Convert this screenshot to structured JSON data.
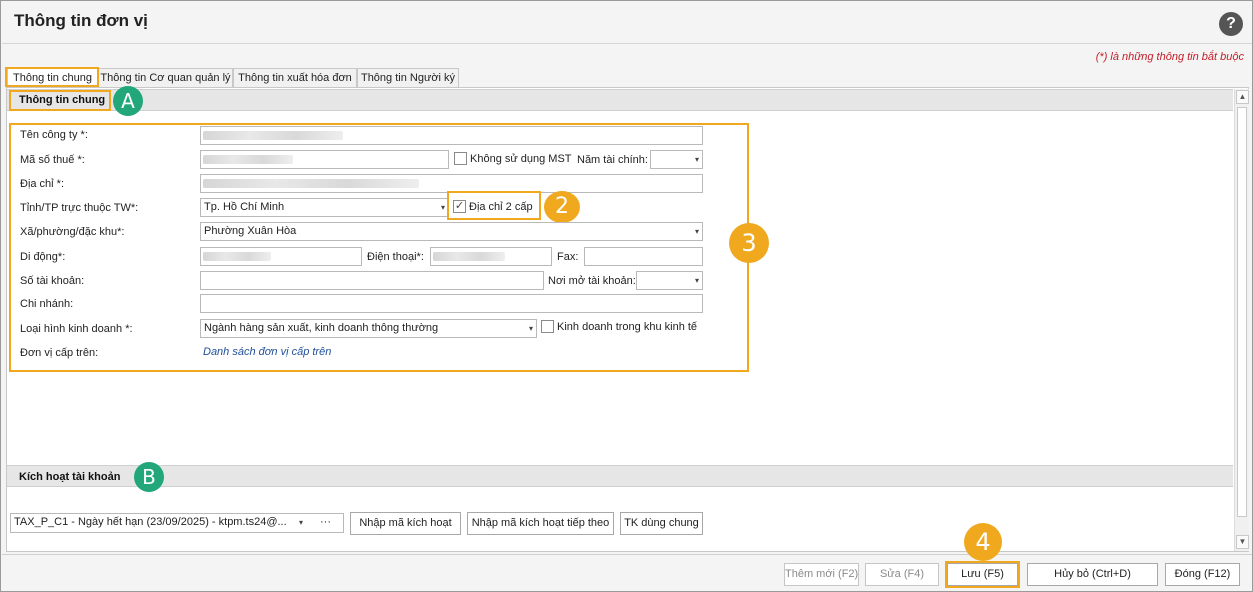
{
  "window": {
    "title": "Thông tin đơn vị",
    "help_label": "?"
  },
  "required_note": "(*)  là những thông tin bắt buộc",
  "tabs": [
    {
      "label": "Thông tin chung"
    },
    {
      "label": "Thông tin Cơ quan quản lý"
    },
    {
      "label": "Thông tin xuất hóa đơn"
    },
    {
      "label": "Thông tin Người ký"
    }
  ],
  "section_general": {
    "title": "Thông tin chung",
    "badge": "A"
  },
  "section_activation": {
    "title": "Kích hoạt tài khoản",
    "badge": "B"
  },
  "form": {
    "company_name_label": "Tên công ty *:",
    "tax_code_label": "Mã số thuế *:",
    "no_tax_code_label": "Không sử dụng MST",
    "fiscal_year_label": "Năm tài chính:",
    "address_label": "Địa chỉ *:",
    "province_label": "Tỉnh/TP trực thuộc TW*:",
    "province_value": "Tp. Hồ Chí Minh",
    "two_level_address_label": "Địa chỉ 2 cấp",
    "ward_label": "Xã/phường/đặc khu*:",
    "ward_value": "Phường Xuân Hòa",
    "mobile_label": "Di động*:",
    "phone_label": "Điện thoại*:",
    "fax_label": "Fax:",
    "account_no_label": "Số tài khoản:",
    "bank_label": "Nơi mở tài khoản:",
    "branch_label": "Chi nhánh:",
    "business_type_label": "Loại hình kinh doanh *:",
    "business_type_value": "Ngành hàng sản xuất, kinh doanh thông thường",
    "economic_zone_label": "Kinh doanh trong khu kinh tế",
    "parent_unit_label": "Đơn vị cấp trên:",
    "parent_unit_link": "Danh sách đơn vị cấp trên"
  },
  "activation": {
    "license_value": "TAX_P_C1 - Ngày hết hạn (23/09/2025) - ktpm.ts24@...",
    "more_label": "···",
    "enter_code_label": "Nhập mã kích hoạt",
    "enter_next_code_label": "Nhập mã kích hoạt tiếp theo",
    "shared_account_label": "TK dùng chung"
  },
  "footer": {
    "add_label": "Thêm mới (F2)",
    "edit_label": "Sửa (F4)",
    "save_label": "Lưu (F5)",
    "cancel_label": "Hủy bỏ (Ctrl+D)",
    "close_label": "Đóng (F12)"
  },
  "callouts": {
    "two": "2",
    "three": "3",
    "four": "4"
  },
  "icons": {
    "dropdown": "▾",
    "check": "✓",
    "scroll_up": "▲",
    "scroll_down": "▼"
  },
  "colors": {
    "highlight": "#f0a81e",
    "badge_green": "#22a77a",
    "required_red": "#c0202a",
    "link_blue": "#1f4e9a"
  }
}
